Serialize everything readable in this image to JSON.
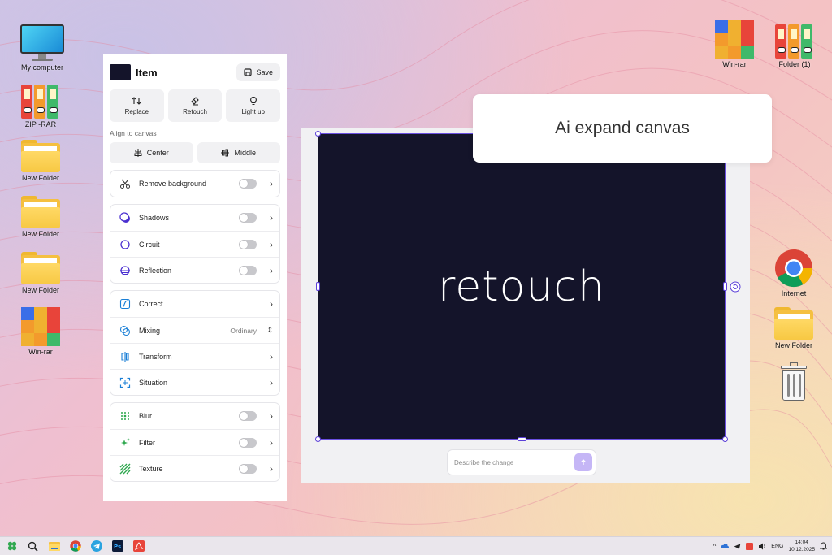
{
  "desktop": {
    "left_icons": [
      {
        "label": "My computer",
        "icon": "monitor-icon"
      },
      {
        "label": "ZIP -RAR",
        "icon": "binders-icon"
      },
      {
        "label": "New Folder",
        "icon": "folder-icon"
      },
      {
        "label": "New Folder",
        "icon": "folder-icon"
      },
      {
        "label": "New Folder",
        "icon": "folder-icon"
      },
      {
        "label": "Win-rar",
        "icon": "winrar-icon"
      }
    ],
    "right_icons": [
      {
        "label": "Win-rar",
        "icon": "winrar-icon"
      },
      {
        "label": "Folder (1)",
        "icon": "binders-icon"
      },
      {
        "label": "Internet",
        "icon": "chrome-icon"
      },
      {
        "label": "New Folder",
        "icon": "folder-icon"
      },
      {
        "label": "",
        "icon": "recycle-bin-icon"
      }
    ]
  },
  "panel": {
    "title": "Item",
    "save_label": "Save",
    "tools": [
      {
        "label": "Replace",
        "icon": "replace-icon"
      },
      {
        "label": "Retouch",
        "icon": "eraser-icon"
      },
      {
        "label": "Light up",
        "icon": "bulb-icon"
      }
    ],
    "align_label": "Align to canvas",
    "align_buttons": [
      {
        "label": "Center",
        "icon": "align-center-icon"
      },
      {
        "label": "Middle",
        "icon": "align-middle-icon"
      }
    ],
    "remove_bg": {
      "label": "Remove background",
      "icon": "scissors-icon",
      "enabled": false
    },
    "effects": [
      {
        "label": "Shadows",
        "icon": "shadow-icon",
        "enabled": false
      },
      {
        "label": "Circuit",
        "icon": "circle-icon",
        "enabled": false
      },
      {
        "label": "Reflection",
        "icon": "reflection-icon",
        "enabled": false
      }
    ],
    "adjust": [
      {
        "label": "Correct",
        "icon": "curve-icon"
      },
      {
        "label": "Mixing",
        "icon": "mixing-icon",
        "value": "Ordinary"
      },
      {
        "label": "Transform",
        "icon": "transform-icon"
      },
      {
        "label": "Situation",
        "icon": "situation-icon"
      }
    ],
    "filters": [
      {
        "label": "Blur",
        "icon": "blur-icon",
        "enabled": false
      },
      {
        "label": "Filter",
        "icon": "sparkle-icon",
        "enabled": false
      },
      {
        "label": "Texture",
        "icon": "texture-icon",
        "enabled": false
      }
    ]
  },
  "canvas": {
    "text": "retouch",
    "background": "#14142a",
    "selection_color": "#5b3fd8"
  },
  "tooltip": {
    "text": "Ai expand canvas"
  },
  "prompt": {
    "placeholder": "Describe the change"
  },
  "taskbar": {
    "apps": [
      "windows-icon",
      "search-icon",
      "file-explorer-icon",
      "chrome-icon",
      "telegram-icon",
      "photoshop-icon",
      "acrobat-icon"
    ],
    "lang": "ENG",
    "time": "14:04",
    "date": "10.12.2025"
  },
  "colors": {
    "accent": "#6a4fe0",
    "send_button": "#c5b6f6"
  }
}
